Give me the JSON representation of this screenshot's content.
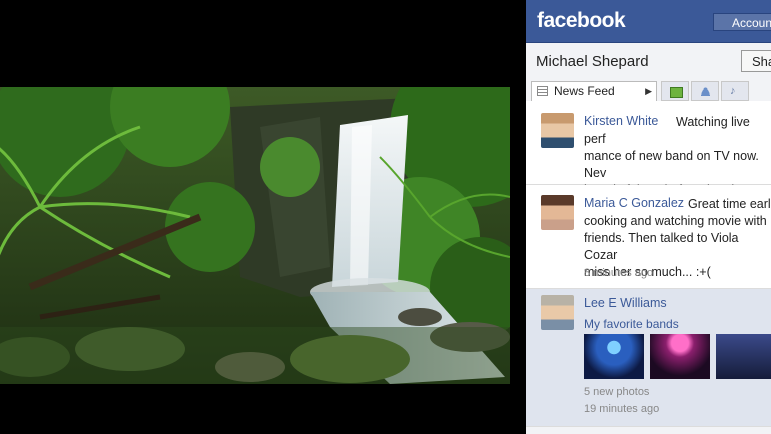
{
  "photo": {
    "description_icon": "waterfall-forest-image"
  },
  "facebook": {
    "logo": "facebook",
    "account_button": "Account",
    "profile_name": "Michael Shepard",
    "share_button": "Sha",
    "tabs": {
      "news_feed": "News Feed"
    },
    "posts": [
      {
        "name": "Kirsten White",
        "text": "Watching live perf\nmance of new band on TV now. Nev\nheard of them before, but they ar\nawesome!!"
      },
      {
        "name": "Maria C Gonzalez",
        "text": "Great time earl\ncooking and watching movie with\nfriends. Then talked to Viola Cozar\nmiss her so much... :+(",
        "time": "8 minutes ago"
      },
      {
        "name": "Lee E Williams",
        "link": "My favorite bands",
        "count": "5 new photos",
        "time": "19 minutes ago"
      }
    ]
  }
}
